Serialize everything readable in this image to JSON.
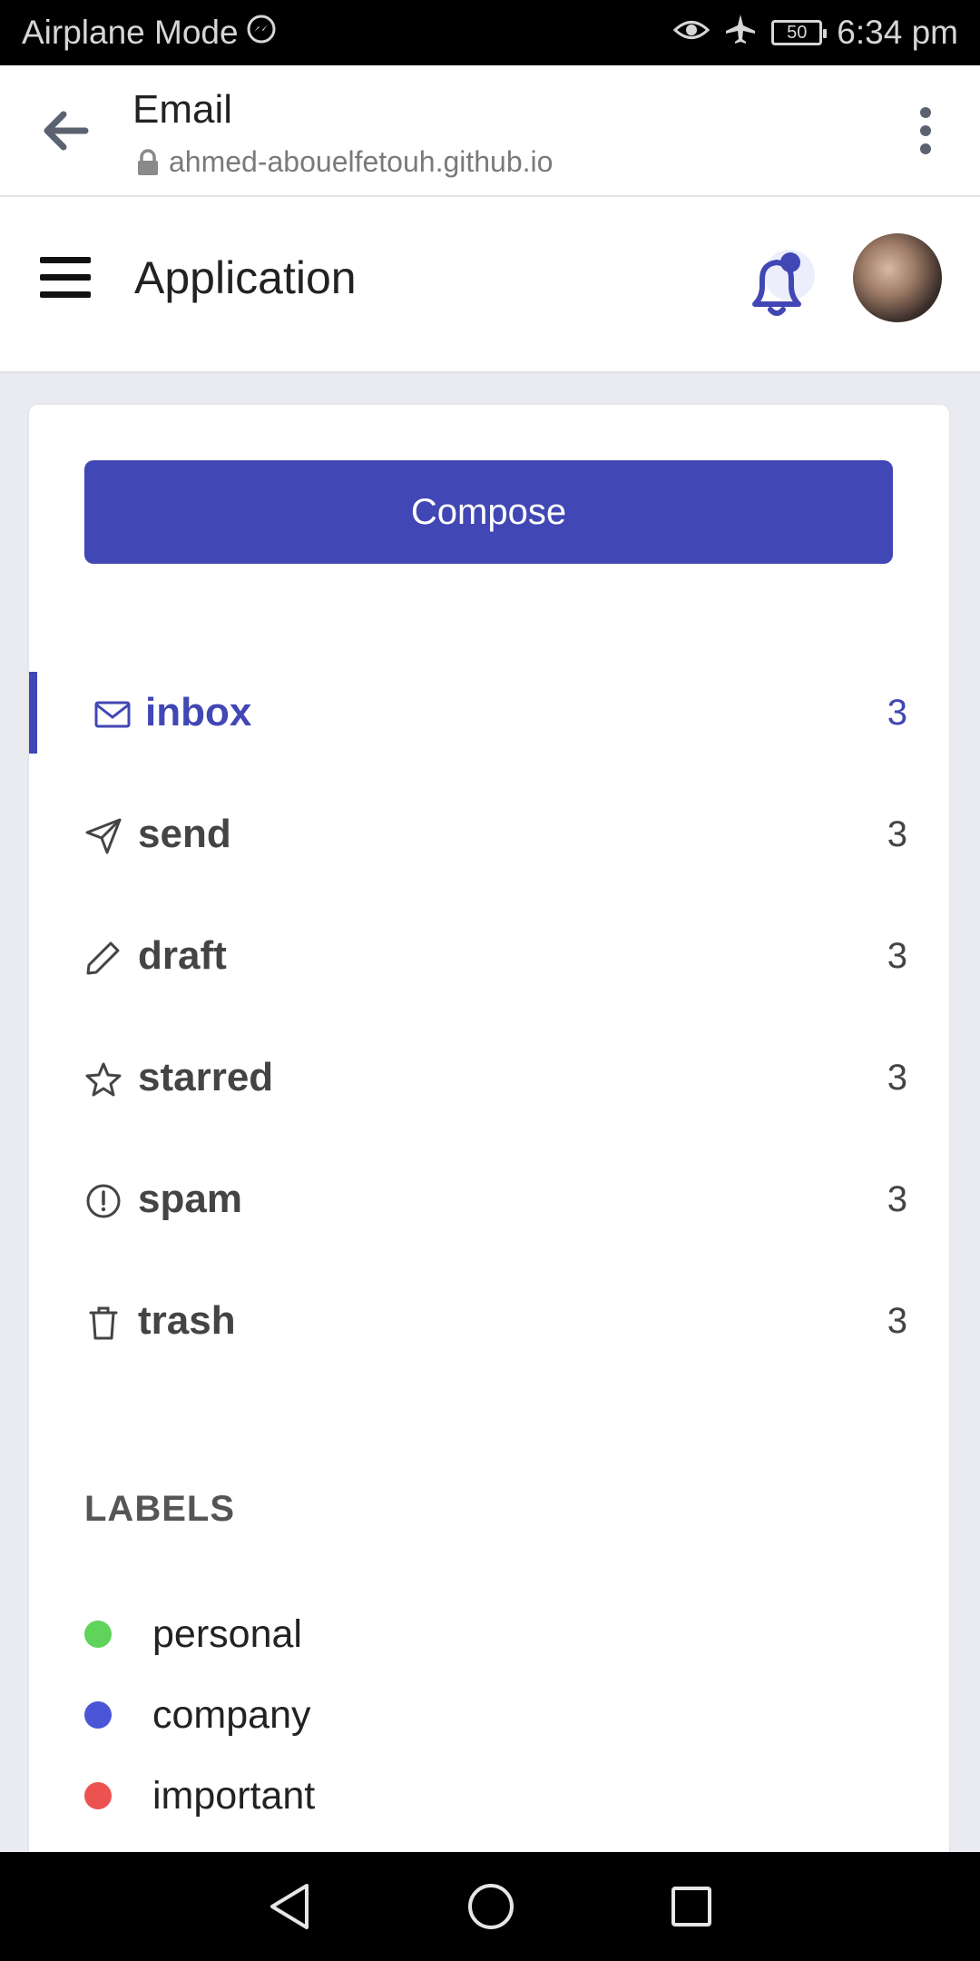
{
  "status_bar": {
    "left_text": "Airplane Mode",
    "battery": "50",
    "time": "6:34 pm"
  },
  "browser": {
    "title": "Email",
    "url": "ahmed-abouelfetouh.github.io"
  },
  "app": {
    "title": "Application"
  },
  "compose_label": "Compose",
  "nav": [
    {
      "label": "inbox",
      "count": "3",
      "icon": "mail-icon",
      "active": true
    },
    {
      "label": "send",
      "count": "3",
      "icon": "send-icon",
      "active": false
    },
    {
      "label": "draft",
      "count": "3",
      "icon": "pencil-icon",
      "active": false
    },
    {
      "label": "starred",
      "count": "3",
      "icon": "star-icon",
      "active": false
    },
    {
      "label": "spam",
      "count": "3",
      "icon": "alert-circle-icon",
      "active": false
    },
    {
      "label": "trash",
      "count": "3",
      "icon": "trash-icon",
      "active": false
    }
  ],
  "labels_heading": "LABELS",
  "labels": [
    {
      "name": "personal",
      "color": "#5fd35a"
    },
    {
      "name": "company",
      "color": "#4a56d6"
    },
    {
      "name": "important",
      "color": "#ec5350"
    }
  ],
  "colors": {
    "accent": "#4147b4"
  }
}
